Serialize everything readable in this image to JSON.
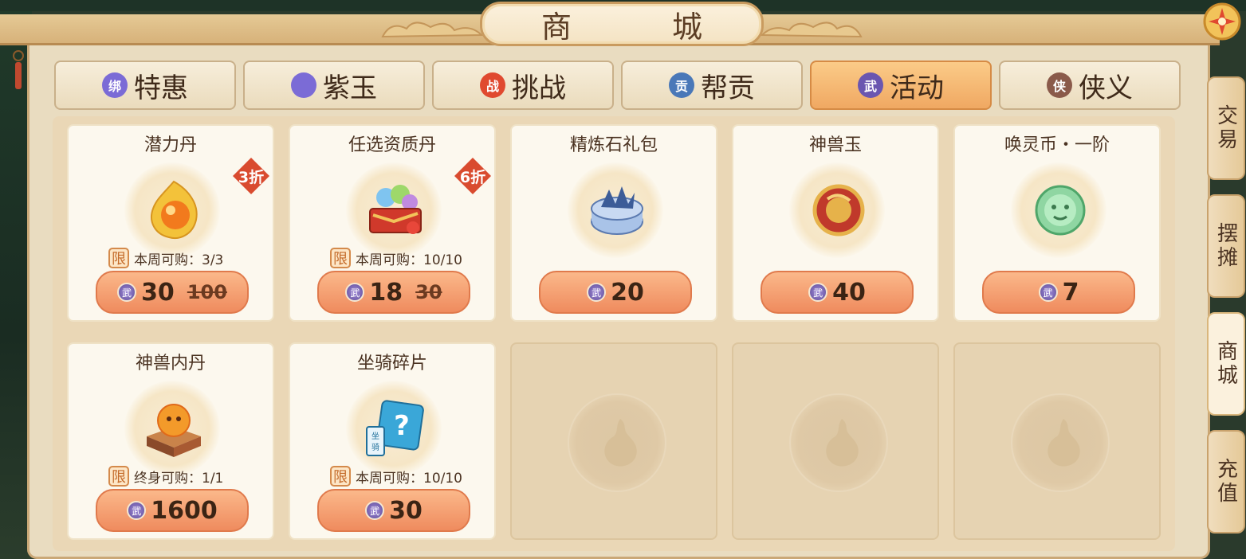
{
  "window": {
    "title": "商　城"
  },
  "tabs": [
    {
      "label": "特惠",
      "icon": "jade-bound-icon",
      "icon_text": "绑",
      "color": "#7b6bd6",
      "active": false
    },
    {
      "label": "紫玉",
      "icon": "purple-jade-icon",
      "icon_text": "",
      "color": "#7b6bd6",
      "active": false
    },
    {
      "label": "挑战",
      "icon": "challenge-icon",
      "icon_text": "战",
      "color": "#e0492f",
      "active": false
    },
    {
      "label": "帮贡",
      "icon": "guild-contribution-icon",
      "icon_text": "贡",
      "color": "#4a78b8",
      "active": false
    },
    {
      "label": "活动",
      "icon": "activity-coin-icon",
      "icon_text": "武",
      "color": "#6a56b0",
      "active": true
    },
    {
      "label": "侠义",
      "icon": "chivalry-icon",
      "icon_text": "侠",
      "color": "#8a5a4a",
      "active": false
    }
  ],
  "items": [
    {
      "name": "潜力丹",
      "discount": "3折",
      "limit_badge": "限",
      "limit_text": "本周可购：3/3",
      "price": "30",
      "old_price": "100",
      "icon": "potential-pill-icon"
    },
    {
      "name": "任选资质丹",
      "discount": "6折",
      "limit_badge": "限",
      "limit_text": "本周可购：10/10",
      "price": "18",
      "old_price": "30",
      "icon": "aptitude-pill-chest-icon"
    },
    {
      "name": "精炼石礼包",
      "discount": "",
      "limit_badge": "",
      "limit_text": "",
      "price": "20",
      "old_price": "",
      "icon": "refining-stone-pack-icon"
    },
    {
      "name": "神兽玉",
      "discount": "",
      "limit_badge": "",
      "limit_text": "",
      "price": "40",
      "old_price": "",
      "icon": "divine-beast-jade-icon"
    },
    {
      "name": "唤灵币・一阶",
      "discount": "",
      "limit_badge": "",
      "limit_text": "",
      "price": "7",
      "old_price": "",
      "icon": "spirit-coin-icon"
    },
    {
      "name": "神兽内丹",
      "discount": "",
      "limit_badge": "限",
      "limit_text": "终身可购：1/1",
      "price": "1600",
      "old_price": "",
      "icon": "beast-core-icon"
    },
    {
      "name": "坐骑碎片",
      "discount": "",
      "limit_badge": "限",
      "limit_text": "本周可购：10/10",
      "price": "30",
      "old_price": "",
      "icon": "mount-fragment-icon",
      "art_text": "坐骑"
    }
  ],
  "currency_icon_text": "武",
  "side_tabs": [
    {
      "label": "交易",
      "active": false
    },
    {
      "label": "摆摊",
      "active": false
    },
    {
      "label": "商城",
      "active": true
    },
    {
      "label": "充值",
      "active": false
    }
  ],
  "colors": {
    "accent": "#f0a862",
    "price_button": "#ef8b5e",
    "discount": "#d94b2f"
  }
}
